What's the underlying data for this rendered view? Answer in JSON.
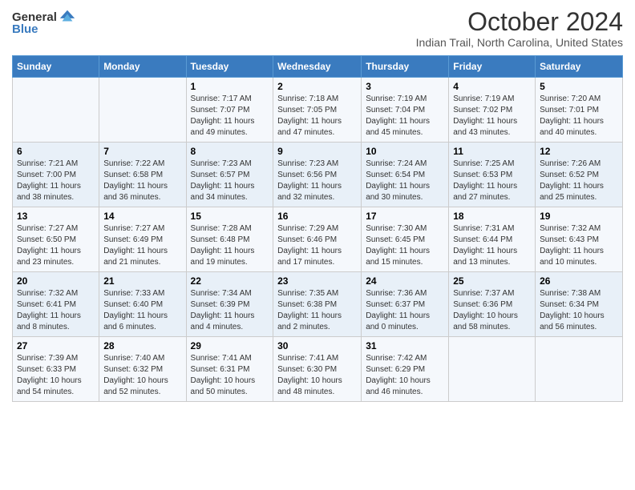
{
  "header": {
    "logo_general": "General",
    "logo_blue": "Blue",
    "title": "October 2024",
    "subtitle": "Indian Trail, North Carolina, United States"
  },
  "weekdays": [
    "Sunday",
    "Monday",
    "Tuesday",
    "Wednesday",
    "Thursday",
    "Friday",
    "Saturday"
  ],
  "weeks": [
    [
      {
        "day": "",
        "info": ""
      },
      {
        "day": "",
        "info": ""
      },
      {
        "day": "1",
        "info": "Sunrise: 7:17 AM\nSunset: 7:07 PM\nDaylight: 11 hours and 49 minutes."
      },
      {
        "day": "2",
        "info": "Sunrise: 7:18 AM\nSunset: 7:05 PM\nDaylight: 11 hours and 47 minutes."
      },
      {
        "day": "3",
        "info": "Sunrise: 7:19 AM\nSunset: 7:04 PM\nDaylight: 11 hours and 45 minutes."
      },
      {
        "day": "4",
        "info": "Sunrise: 7:19 AM\nSunset: 7:02 PM\nDaylight: 11 hours and 43 minutes."
      },
      {
        "day": "5",
        "info": "Sunrise: 7:20 AM\nSunset: 7:01 PM\nDaylight: 11 hours and 40 minutes."
      }
    ],
    [
      {
        "day": "6",
        "info": "Sunrise: 7:21 AM\nSunset: 7:00 PM\nDaylight: 11 hours and 38 minutes."
      },
      {
        "day": "7",
        "info": "Sunrise: 7:22 AM\nSunset: 6:58 PM\nDaylight: 11 hours and 36 minutes."
      },
      {
        "day": "8",
        "info": "Sunrise: 7:23 AM\nSunset: 6:57 PM\nDaylight: 11 hours and 34 minutes."
      },
      {
        "day": "9",
        "info": "Sunrise: 7:23 AM\nSunset: 6:56 PM\nDaylight: 11 hours and 32 minutes."
      },
      {
        "day": "10",
        "info": "Sunrise: 7:24 AM\nSunset: 6:54 PM\nDaylight: 11 hours and 30 minutes."
      },
      {
        "day": "11",
        "info": "Sunrise: 7:25 AM\nSunset: 6:53 PM\nDaylight: 11 hours and 27 minutes."
      },
      {
        "day": "12",
        "info": "Sunrise: 7:26 AM\nSunset: 6:52 PM\nDaylight: 11 hours and 25 minutes."
      }
    ],
    [
      {
        "day": "13",
        "info": "Sunrise: 7:27 AM\nSunset: 6:50 PM\nDaylight: 11 hours and 23 minutes."
      },
      {
        "day": "14",
        "info": "Sunrise: 7:27 AM\nSunset: 6:49 PM\nDaylight: 11 hours and 21 minutes."
      },
      {
        "day": "15",
        "info": "Sunrise: 7:28 AM\nSunset: 6:48 PM\nDaylight: 11 hours and 19 minutes."
      },
      {
        "day": "16",
        "info": "Sunrise: 7:29 AM\nSunset: 6:46 PM\nDaylight: 11 hours and 17 minutes."
      },
      {
        "day": "17",
        "info": "Sunrise: 7:30 AM\nSunset: 6:45 PM\nDaylight: 11 hours and 15 minutes."
      },
      {
        "day": "18",
        "info": "Sunrise: 7:31 AM\nSunset: 6:44 PM\nDaylight: 11 hours and 13 minutes."
      },
      {
        "day": "19",
        "info": "Sunrise: 7:32 AM\nSunset: 6:43 PM\nDaylight: 11 hours and 10 minutes."
      }
    ],
    [
      {
        "day": "20",
        "info": "Sunrise: 7:32 AM\nSunset: 6:41 PM\nDaylight: 11 hours and 8 minutes."
      },
      {
        "day": "21",
        "info": "Sunrise: 7:33 AM\nSunset: 6:40 PM\nDaylight: 11 hours and 6 minutes."
      },
      {
        "day": "22",
        "info": "Sunrise: 7:34 AM\nSunset: 6:39 PM\nDaylight: 11 hours and 4 minutes."
      },
      {
        "day": "23",
        "info": "Sunrise: 7:35 AM\nSunset: 6:38 PM\nDaylight: 11 hours and 2 minutes."
      },
      {
        "day": "24",
        "info": "Sunrise: 7:36 AM\nSunset: 6:37 PM\nDaylight: 11 hours and 0 minutes."
      },
      {
        "day": "25",
        "info": "Sunrise: 7:37 AM\nSunset: 6:36 PM\nDaylight: 10 hours and 58 minutes."
      },
      {
        "day": "26",
        "info": "Sunrise: 7:38 AM\nSunset: 6:34 PM\nDaylight: 10 hours and 56 minutes."
      }
    ],
    [
      {
        "day": "27",
        "info": "Sunrise: 7:39 AM\nSunset: 6:33 PM\nDaylight: 10 hours and 54 minutes."
      },
      {
        "day": "28",
        "info": "Sunrise: 7:40 AM\nSunset: 6:32 PM\nDaylight: 10 hours and 52 minutes."
      },
      {
        "day": "29",
        "info": "Sunrise: 7:41 AM\nSunset: 6:31 PM\nDaylight: 10 hours and 50 minutes."
      },
      {
        "day": "30",
        "info": "Sunrise: 7:41 AM\nSunset: 6:30 PM\nDaylight: 10 hours and 48 minutes."
      },
      {
        "day": "31",
        "info": "Sunrise: 7:42 AM\nSunset: 6:29 PM\nDaylight: 10 hours and 46 minutes."
      },
      {
        "day": "",
        "info": ""
      },
      {
        "day": "",
        "info": ""
      }
    ]
  ]
}
